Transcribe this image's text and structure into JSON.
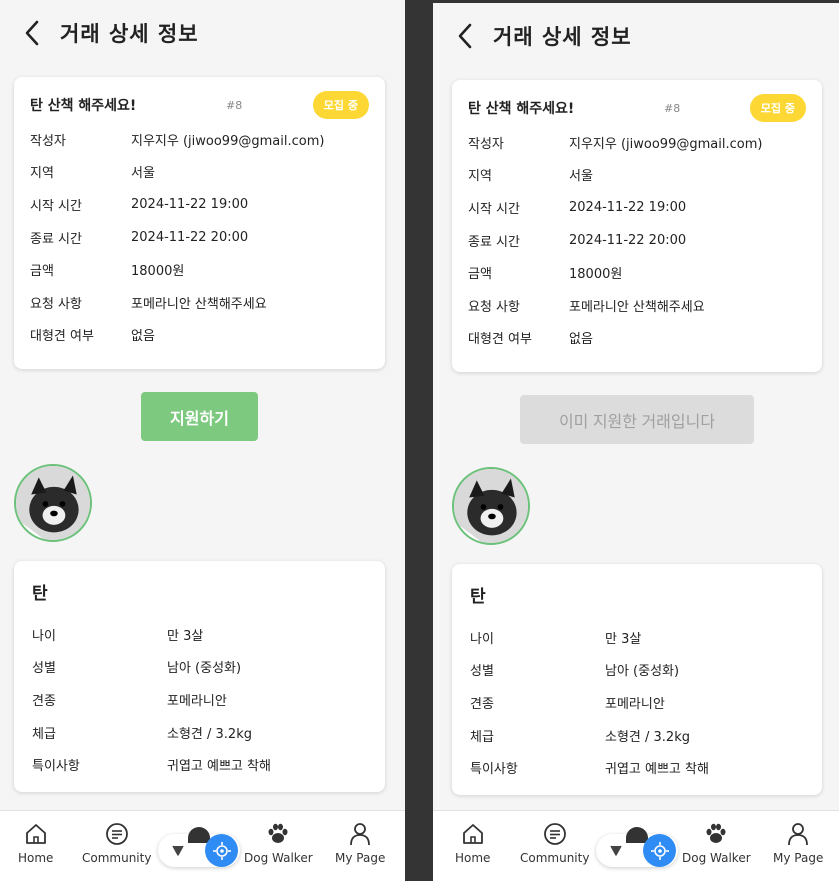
{
  "screens": [
    {
      "header": {
        "title": "거래 상세 정보"
      },
      "post": {
        "title": "탄 산책 해주세요!",
        "id": "#8",
        "status": "모집 중",
        "fields": [
          {
            "label": "작성자",
            "value": "지우지우 (jiwoo99@gmail.com)"
          },
          {
            "label": "지역",
            "value": "서울"
          },
          {
            "label": "시작 시간",
            "value": "2024-11-22 19:00"
          },
          {
            "label": "종료 시간",
            "value": "2024-11-22 20:00"
          },
          {
            "label": "금액",
            "value": "18000원"
          },
          {
            "label": "요청 사항",
            "value": "포메라니안 산책해주세요"
          },
          {
            "label": "대형견 여부",
            "value": "없음"
          }
        ]
      },
      "action": {
        "label": "지원하기",
        "state": "enabled"
      },
      "dog": {
        "name": "탄",
        "fields": [
          {
            "label": "나이",
            "value": "만 3살"
          },
          {
            "label": "성별",
            "value": "남아 (중성화)"
          },
          {
            "label": "견종",
            "value": "포메라니안"
          },
          {
            "label": "체급",
            "value": "소형견 / 3.2kg"
          },
          {
            "label": "특이사항",
            "value": "귀엽고 예쁘고 착해"
          }
        ]
      }
    },
    {
      "header": {
        "title": "거래 상세 정보"
      },
      "post": {
        "title": "탄 산책 해주세요!",
        "id": "#8",
        "status": "모집 중",
        "fields": [
          {
            "label": "작성자",
            "value": "지우지우 (jiwoo99@gmail.com)"
          },
          {
            "label": "지역",
            "value": "서울"
          },
          {
            "label": "시작 시간",
            "value": "2024-11-22 19:00"
          },
          {
            "label": "종료 시간",
            "value": "2024-11-22 20:00"
          },
          {
            "label": "금액",
            "value": "18000원"
          },
          {
            "label": "요청 사항",
            "value": "포메라니안 산책해주세요"
          },
          {
            "label": "대형견 여부",
            "value": "없음"
          }
        ]
      },
      "action": {
        "label": "이미 지원한 거래입니다",
        "state": "disabled"
      },
      "dog": {
        "name": "탄",
        "fields": [
          {
            "label": "나이",
            "value": "만 3살"
          },
          {
            "label": "성별",
            "value": "남아 (중성화)"
          },
          {
            "label": "견종",
            "value": "포메라니안"
          },
          {
            "label": "체급",
            "value": "소형견 / 3.2kg"
          },
          {
            "label": "특이사항",
            "value": "귀엽고 예쁘고 착해"
          }
        ]
      }
    }
  ],
  "nav": {
    "items": [
      {
        "label": "Home",
        "icon": "home-icon"
      },
      {
        "label": "Community",
        "icon": "community-icon"
      },
      {
        "label": "Dog Walker",
        "icon": "paw-icon"
      },
      {
        "label": "My Page",
        "icon": "person-icon"
      }
    ],
    "center": {
      "collapse_icon": "chevron-down-icon",
      "locate_icon": "locate-icon"
    }
  },
  "colors": {
    "accent_green": "#7dc97f",
    "badge_yellow": "#fdd835",
    "locate_blue": "#2f8cf4",
    "disabled_gray": "#dcdcdc",
    "avatar_ring": "#6cc27a"
  }
}
